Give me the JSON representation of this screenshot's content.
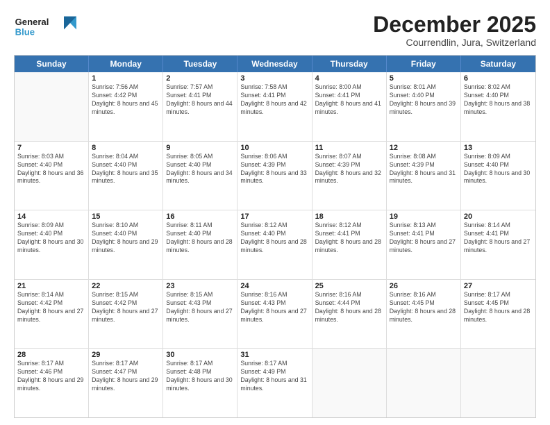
{
  "logo": {
    "text_general": "General",
    "text_blue": "Blue"
  },
  "title": "December 2025",
  "subtitle": "Courrendlin, Jura, Switzerland",
  "days_of_week": [
    "Sunday",
    "Monday",
    "Tuesday",
    "Wednesday",
    "Thursday",
    "Friday",
    "Saturday"
  ],
  "weeks": [
    [
      {
        "day": "",
        "empty": true
      },
      {
        "day": "1",
        "sunrise": "Sunrise: 7:56 AM",
        "sunset": "Sunset: 4:42 PM",
        "daylight": "Daylight: 8 hours and 45 minutes."
      },
      {
        "day": "2",
        "sunrise": "Sunrise: 7:57 AM",
        "sunset": "Sunset: 4:41 PM",
        "daylight": "Daylight: 8 hours and 44 minutes."
      },
      {
        "day": "3",
        "sunrise": "Sunrise: 7:58 AM",
        "sunset": "Sunset: 4:41 PM",
        "daylight": "Daylight: 8 hours and 42 minutes."
      },
      {
        "day": "4",
        "sunrise": "Sunrise: 8:00 AM",
        "sunset": "Sunset: 4:41 PM",
        "daylight": "Daylight: 8 hours and 41 minutes."
      },
      {
        "day": "5",
        "sunrise": "Sunrise: 8:01 AM",
        "sunset": "Sunset: 4:40 PM",
        "daylight": "Daylight: 8 hours and 39 minutes."
      },
      {
        "day": "6",
        "sunrise": "Sunrise: 8:02 AM",
        "sunset": "Sunset: 4:40 PM",
        "daylight": "Daylight: 8 hours and 38 minutes."
      }
    ],
    [
      {
        "day": "7",
        "sunrise": "Sunrise: 8:03 AM",
        "sunset": "Sunset: 4:40 PM",
        "daylight": "Daylight: 8 hours and 36 minutes."
      },
      {
        "day": "8",
        "sunrise": "Sunrise: 8:04 AM",
        "sunset": "Sunset: 4:40 PM",
        "daylight": "Daylight: 8 hours and 35 minutes."
      },
      {
        "day": "9",
        "sunrise": "Sunrise: 8:05 AM",
        "sunset": "Sunset: 4:40 PM",
        "daylight": "Daylight: 8 hours and 34 minutes."
      },
      {
        "day": "10",
        "sunrise": "Sunrise: 8:06 AM",
        "sunset": "Sunset: 4:39 PM",
        "daylight": "Daylight: 8 hours and 33 minutes."
      },
      {
        "day": "11",
        "sunrise": "Sunrise: 8:07 AM",
        "sunset": "Sunset: 4:39 PM",
        "daylight": "Daylight: 8 hours and 32 minutes."
      },
      {
        "day": "12",
        "sunrise": "Sunrise: 8:08 AM",
        "sunset": "Sunset: 4:39 PM",
        "daylight": "Daylight: 8 hours and 31 minutes."
      },
      {
        "day": "13",
        "sunrise": "Sunrise: 8:09 AM",
        "sunset": "Sunset: 4:40 PM",
        "daylight": "Daylight: 8 hours and 30 minutes."
      }
    ],
    [
      {
        "day": "14",
        "sunrise": "Sunrise: 8:09 AM",
        "sunset": "Sunset: 4:40 PM",
        "daylight": "Daylight: 8 hours and 30 minutes."
      },
      {
        "day": "15",
        "sunrise": "Sunrise: 8:10 AM",
        "sunset": "Sunset: 4:40 PM",
        "daylight": "Daylight: 8 hours and 29 minutes."
      },
      {
        "day": "16",
        "sunrise": "Sunrise: 8:11 AM",
        "sunset": "Sunset: 4:40 PM",
        "daylight": "Daylight: 8 hours and 28 minutes."
      },
      {
        "day": "17",
        "sunrise": "Sunrise: 8:12 AM",
        "sunset": "Sunset: 4:40 PM",
        "daylight": "Daylight: 8 hours and 28 minutes."
      },
      {
        "day": "18",
        "sunrise": "Sunrise: 8:12 AM",
        "sunset": "Sunset: 4:41 PM",
        "daylight": "Daylight: 8 hours and 28 minutes."
      },
      {
        "day": "19",
        "sunrise": "Sunrise: 8:13 AM",
        "sunset": "Sunset: 4:41 PM",
        "daylight": "Daylight: 8 hours and 27 minutes."
      },
      {
        "day": "20",
        "sunrise": "Sunrise: 8:14 AM",
        "sunset": "Sunset: 4:41 PM",
        "daylight": "Daylight: 8 hours and 27 minutes."
      }
    ],
    [
      {
        "day": "21",
        "sunrise": "Sunrise: 8:14 AM",
        "sunset": "Sunset: 4:42 PM",
        "daylight": "Daylight: 8 hours and 27 minutes."
      },
      {
        "day": "22",
        "sunrise": "Sunrise: 8:15 AM",
        "sunset": "Sunset: 4:42 PM",
        "daylight": "Daylight: 8 hours and 27 minutes."
      },
      {
        "day": "23",
        "sunrise": "Sunrise: 8:15 AM",
        "sunset": "Sunset: 4:43 PM",
        "daylight": "Daylight: 8 hours and 27 minutes."
      },
      {
        "day": "24",
        "sunrise": "Sunrise: 8:16 AM",
        "sunset": "Sunset: 4:43 PM",
        "daylight": "Daylight: 8 hours and 27 minutes."
      },
      {
        "day": "25",
        "sunrise": "Sunrise: 8:16 AM",
        "sunset": "Sunset: 4:44 PM",
        "daylight": "Daylight: 8 hours and 28 minutes."
      },
      {
        "day": "26",
        "sunrise": "Sunrise: 8:16 AM",
        "sunset": "Sunset: 4:45 PM",
        "daylight": "Daylight: 8 hours and 28 minutes."
      },
      {
        "day": "27",
        "sunrise": "Sunrise: 8:17 AM",
        "sunset": "Sunset: 4:45 PM",
        "daylight": "Daylight: 8 hours and 28 minutes."
      }
    ],
    [
      {
        "day": "28",
        "sunrise": "Sunrise: 8:17 AM",
        "sunset": "Sunset: 4:46 PM",
        "daylight": "Daylight: 8 hours and 29 minutes."
      },
      {
        "day": "29",
        "sunrise": "Sunrise: 8:17 AM",
        "sunset": "Sunset: 4:47 PM",
        "daylight": "Daylight: 8 hours and 29 minutes."
      },
      {
        "day": "30",
        "sunrise": "Sunrise: 8:17 AM",
        "sunset": "Sunset: 4:48 PM",
        "daylight": "Daylight: 8 hours and 30 minutes."
      },
      {
        "day": "31",
        "sunrise": "Sunrise: 8:17 AM",
        "sunset": "Sunset: 4:49 PM",
        "daylight": "Daylight: 8 hours and 31 minutes."
      },
      {
        "day": "",
        "empty": true
      },
      {
        "day": "",
        "empty": true
      },
      {
        "day": "",
        "empty": true
      }
    ]
  ]
}
